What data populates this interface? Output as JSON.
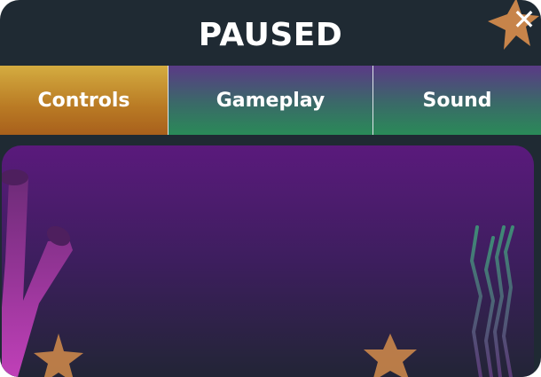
{
  "dialog": {
    "title": "PAUSED",
    "close_symbol": "✕"
  },
  "tabs": [
    {
      "label": "Controls",
      "active": true
    },
    {
      "label": "Gameplay",
      "active": false
    },
    {
      "label": "Sound",
      "active": false
    }
  ],
  "icons": {
    "close": "x-icon",
    "close_backdrop": "starfish-icon",
    "decorations": [
      "coral-icon",
      "starfish-icon",
      "starfish-icon",
      "seaweed-icon"
    ]
  },
  "colors": {
    "panel_bg": "#1f2a33",
    "tab_active": "#c98b2c",
    "tab_inactive_top": "#5a3a86",
    "tab_inactive_bottom": "#2a8a58",
    "content_top": "#5a1a7c",
    "content_bottom": "#222536",
    "starfish": "#c7844a",
    "seaweed": "#4f8f7e",
    "coral": "#a83aa2"
  }
}
